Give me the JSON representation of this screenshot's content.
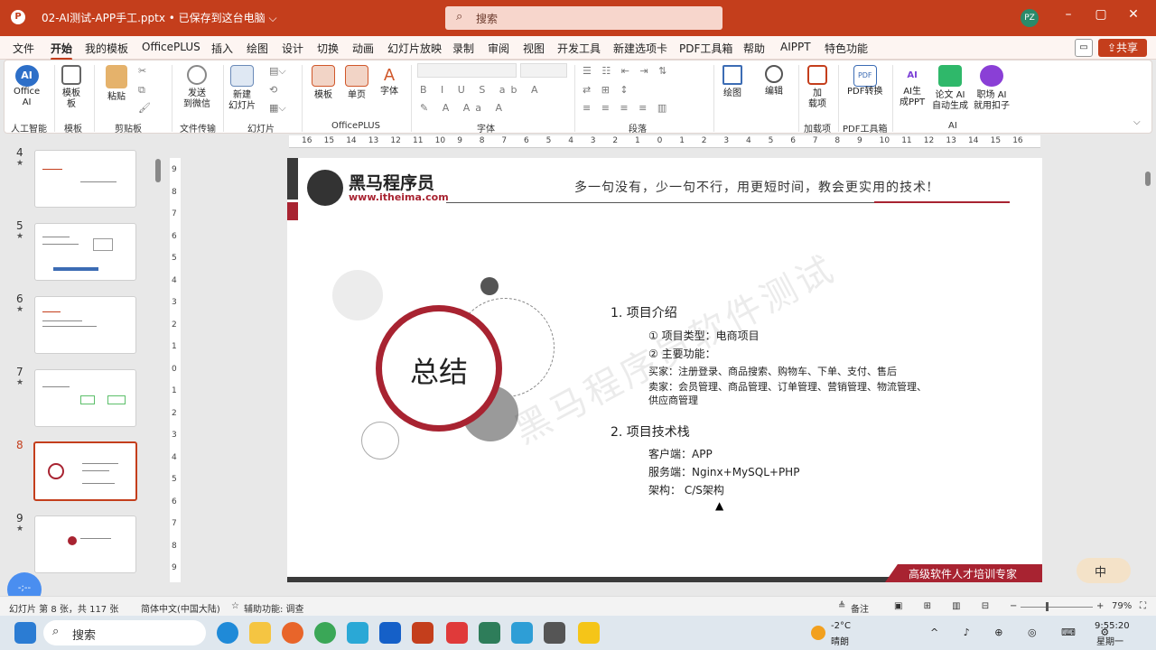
{
  "window": {
    "title": "02-AI测试-APP手工.pptx • 已保存到这台电脑 ⌵",
    "search_placeholder": "搜索",
    "avatar": "PZ"
  },
  "menu": [
    "文件",
    "开始",
    "我的模板",
    "OfficePLUS",
    "插入",
    "绘图",
    "设计",
    "切换",
    "动画",
    "幻灯片放映",
    "录制",
    "审阅",
    "视图",
    "开发工具",
    "新建选项卡",
    "PDF工具箱",
    "帮助",
    "AIPPT",
    "特色功能"
  ],
  "share": "共享",
  "ribbon": {
    "office_ai": "Office\nAI",
    "tmpl": "模板\n板",
    "paste": "粘贴",
    "send": "发送\n到微信",
    "newslide": "新建\n幻灯片",
    "template": "模板",
    "single": "单页",
    "font": "字体",
    "draw": "绘图",
    "edit": "编辑",
    "addon": "加\n载项",
    "pdfconv": "PDF转换",
    "aippt": "AI生\n成PPT",
    "paper": "论文 AI\n自动生成",
    "job": "职场 AI\n就用扣子",
    "groups": [
      "人工智能",
      "模板",
      "剪贴板",
      "文件传输",
      "幻灯片",
      "OfficePLUS",
      "字体",
      "段落",
      "加载项",
      "PDF工具箱",
      "AI"
    ]
  },
  "ruler": [
    "16",
    "15",
    "14",
    "13",
    "12",
    "11",
    "10",
    "9",
    "8",
    "7",
    "6",
    "5",
    "4",
    "3",
    "2",
    "1",
    "0",
    "1",
    "2",
    "3",
    "4",
    "5",
    "6",
    "7",
    "8",
    "9",
    "10",
    "11",
    "12",
    "13",
    "14",
    "15",
    "16"
  ],
  "vruler": [
    "9",
    "8",
    "7",
    "6",
    "5",
    "4",
    "3",
    "2",
    "1",
    "0",
    "1",
    "2",
    "3",
    "4",
    "5",
    "6",
    "7",
    "8",
    "9"
  ],
  "thumbs": [
    {
      "n": "4"
    },
    {
      "n": "5"
    },
    {
      "n": "6"
    },
    {
      "n": "7"
    },
    {
      "n": "8"
    },
    {
      "n": "9"
    }
  ],
  "slide": {
    "logo": "黑马程序员",
    "logo_url": "www.itheima.com",
    "slogan": "多一句没有，少一句不行，用更短时间，教会更实用的技术!",
    "circle": "总结",
    "watermark": "黑马程序员软件测试",
    "s1_title": "1.  项目介绍",
    "s1_a": "① 项目类型：电商项目",
    "s1_b": "② 主要功能：",
    "s1_c": "买家：注册登录、商品搜索、购物车、下单、支付、售后",
    "s1_d": "卖家：会员管理、商品管理、订单管理、营销管理、物流管理、",
    "s1_e": "供应商管理",
    "s2_title": "2.  项目技术栈",
    "s2_a": "客户端：APP",
    "s2_b": "服务端：Nginx+MySQL+PHP",
    "s2_c": "架构：  C/S架构",
    "footer": "高级软件人才培训专家"
  },
  "status": {
    "slide": "幻灯片 第 8 张，共 117 张",
    "lang": "简体中文(中国大陆)",
    "access": "辅助功能: 调查",
    "notes": "备注",
    "zoom": "79%",
    "ime": "中"
  },
  "taskbar": {
    "search": "搜索",
    "weather_temp": "-2°C",
    "weather_desc": "晴朗",
    "time": "9:55:20",
    "day": "星期一"
  }
}
